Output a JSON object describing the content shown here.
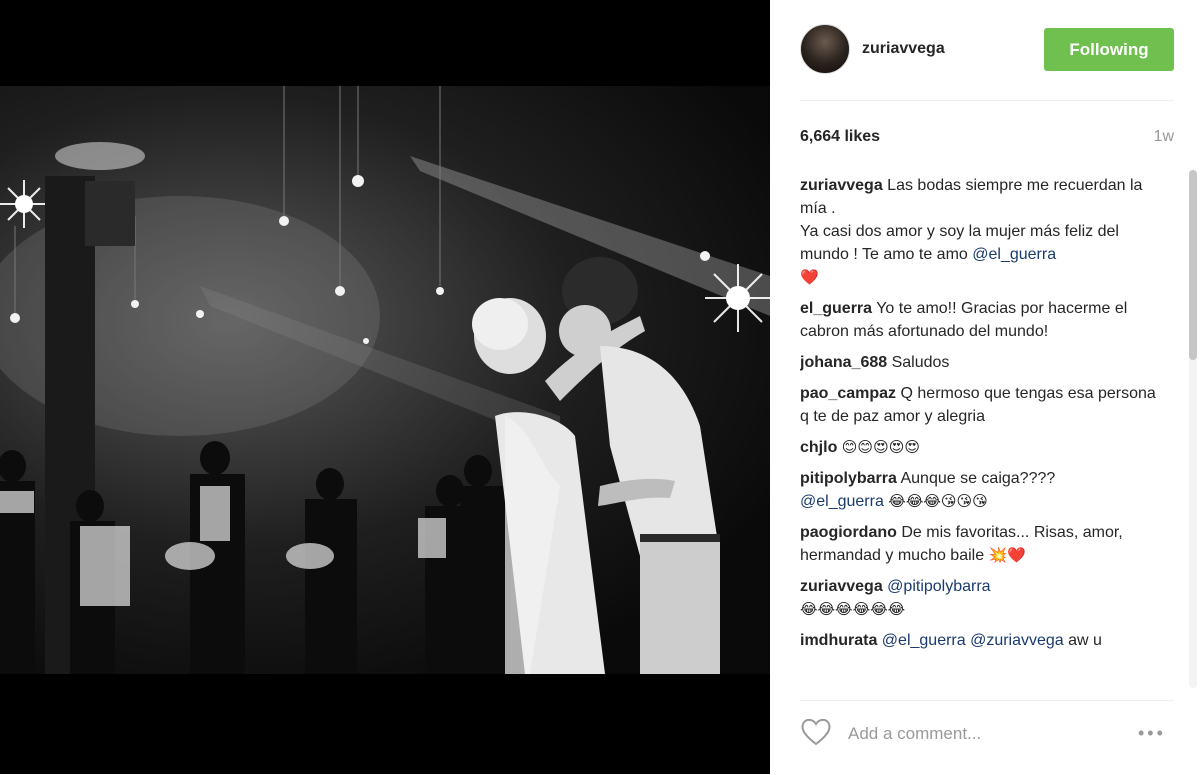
{
  "header": {
    "username": "zuriavvega",
    "follow_label": "Following"
  },
  "post": {
    "likes": "6,664 likes",
    "time_ago": "1w"
  },
  "comments": [
    {
      "user": "zuriavvega",
      "parts": [
        "Las bodas siempre me recuerdan la mía .",
        "Ya casi dos amor y soy la mujer más feliz del mundo ! Te amo te amo "
      ],
      "mention": "@el_guerra",
      "emoji": "❤️"
    },
    {
      "user": "el_guerra",
      "text": "Yo te amo!! Gracias por hacerme el cabron más afortunado del mundo!"
    },
    {
      "user": "johana_688",
      "text": "Saludos"
    },
    {
      "user": "pao_campaz",
      "text": "Q hermoso que tengas esa persona q te de paz amor y alegria"
    },
    {
      "user": "chjlo",
      "emoji": "😊😊😍😍😍"
    },
    {
      "user": "pitipolybarra",
      "text": "Aunque se caiga????",
      "mention": "@el_guerra",
      "emoji": "😂😂😂😘😘😘"
    },
    {
      "user": "paogiordano",
      "text": "De mis favoritas... Risas, amor, hermandad y mucho baile",
      "emoji": "💥❤️"
    },
    {
      "user": "zuriavvega",
      "mention": "@pitipolybarra",
      "emoji": "😂😂😂😂😂😂"
    },
    {
      "user": "imdhurata",
      "mention": "@el_guerra @zuriavvega",
      "text": "aw u"
    }
  ],
  "footer": {
    "comment_placeholder": "Add a comment...",
    "more_label": "•••"
  },
  "colors": {
    "follow_button": "#70c050",
    "mention": "#1a3a6e"
  },
  "icons": {
    "like": "heart-outline-icon",
    "more": "ellipsis-icon"
  }
}
